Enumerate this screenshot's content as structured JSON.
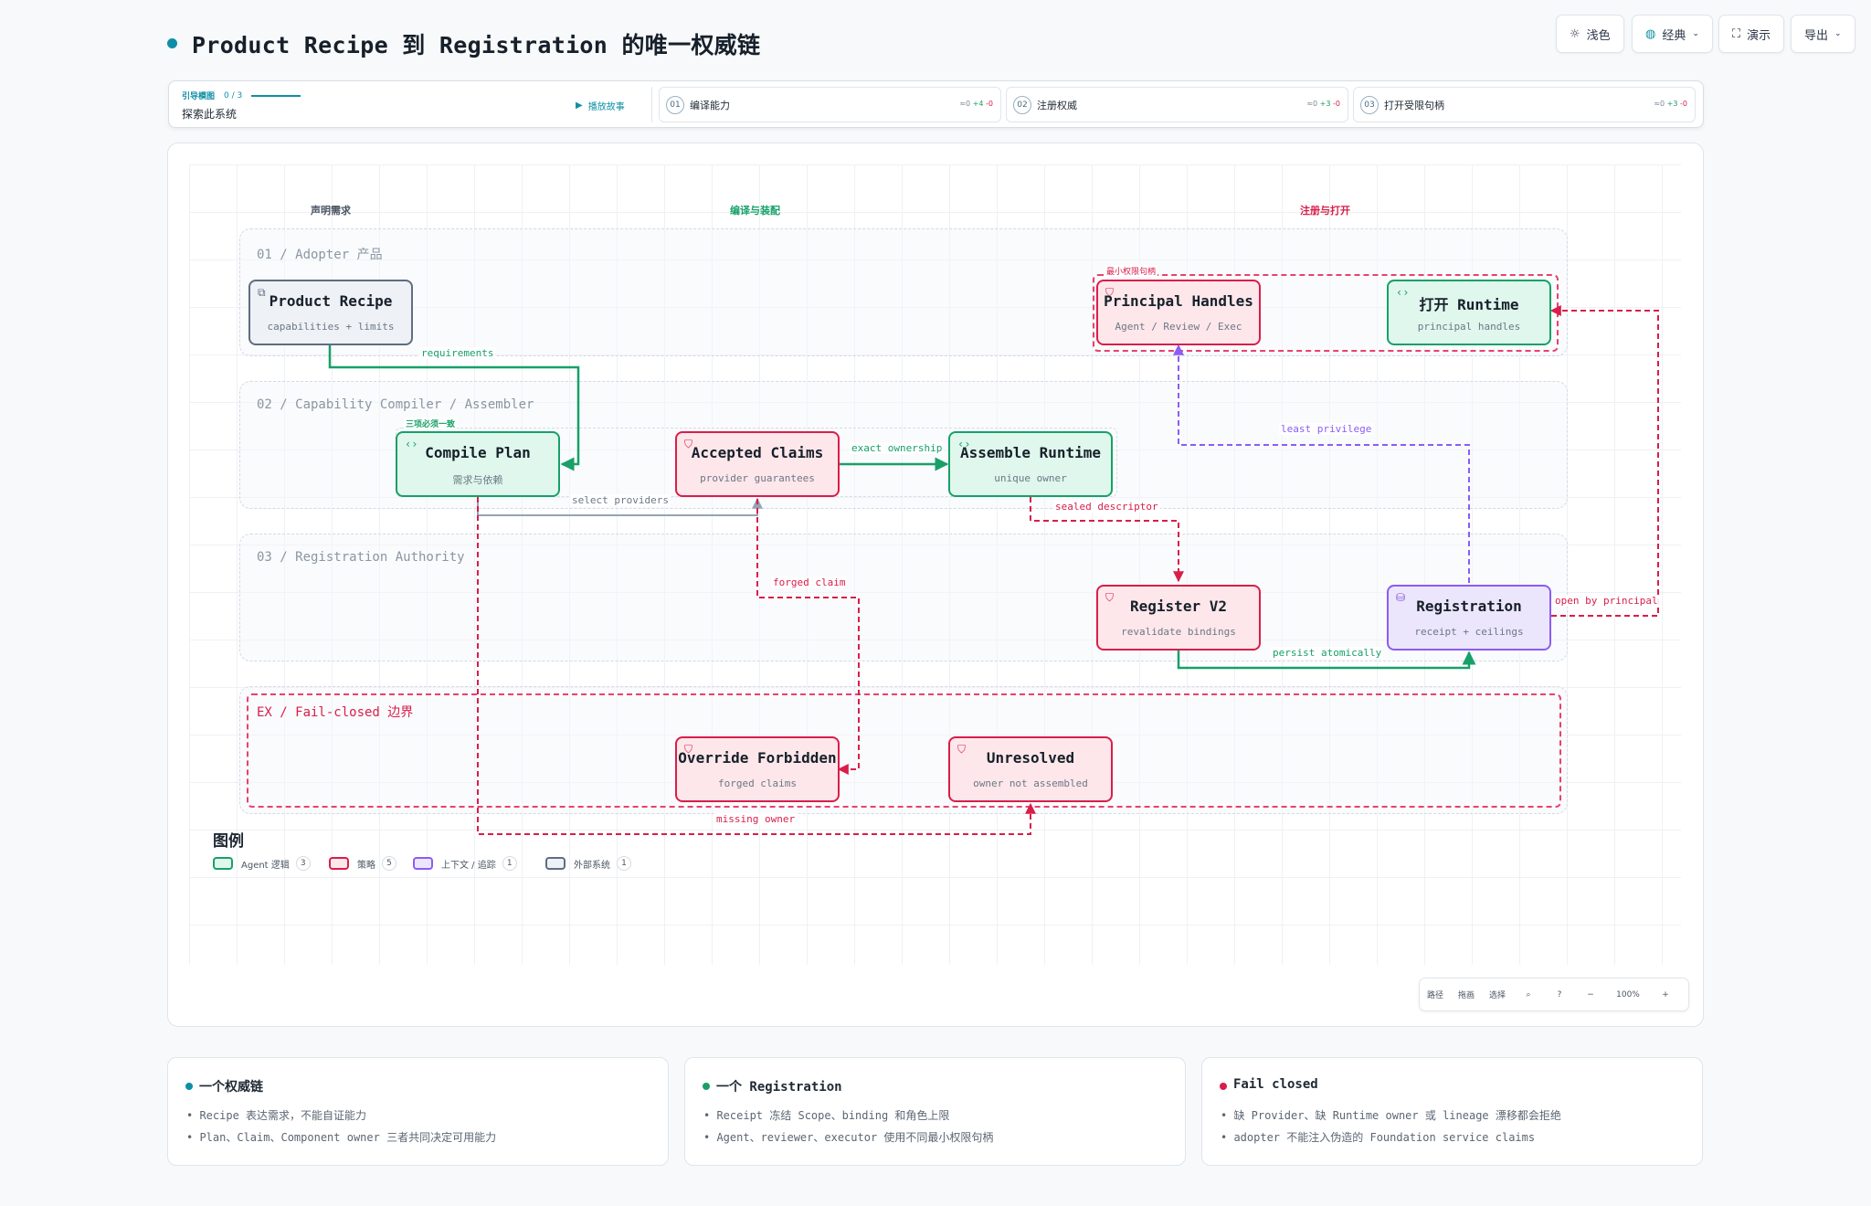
{
  "header": {
    "title": "Product Recipe 到 Registration 的唯一权威链"
  },
  "toolbar": {
    "theme": "浅色",
    "style": "经典",
    "present": "演示",
    "export": "导出"
  },
  "guide": {
    "label": "引导模图",
    "progress": "0 / 3",
    "progress_value": 0,
    "subtitle": "探索此系统",
    "play": "播放故事",
    "steps": [
      {
        "num": "01",
        "label": "编译能力",
        "stat_neutral": "≈0",
        "stat_plus": "+4",
        "stat_minus": "-0"
      },
      {
        "num": "02",
        "label": "注册权威",
        "stat_neutral": "≈0",
        "stat_plus": "+3",
        "stat_minus": "-0"
      },
      {
        "num": "03",
        "label": "打开受限句柄",
        "stat_neutral": "≈0",
        "stat_plus": "+3",
        "stat_minus": "-0"
      }
    ]
  },
  "columns": {
    "declare": "声明需求",
    "compile": "编译与装配",
    "register": "注册与打开"
  },
  "lanes": {
    "l1": "01 / Adopter 产品",
    "l2": "02 / Capability Compiler / Assembler",
    "l3": "03 / Registration Authority",
    "ex": "EX / Fail-closed 边界"
  },
  "groups": {
    "least_handles": "最小权限句柄",
    "three_consistent": "三项必须一致"
  },
  "nodes": {
    "product_recipe": {
      "title": "Product Recipe",
      "sub": "capabilities + limits"
    },
    "principal_handles": {
      "title": "Principal Handles",
      "sub": "Agent / Review / Exec"
    },
    "open_runtime": {
      "title": "打开 Runtime",
      "sub": "principal handles"
    },
    "compile_plan": {
      "title": "Compile Plan",
      "sub": "需求与依赖"
    },
    "accepted_claims": {
      "title": "Accepted Claims",
      "sub": "provider guarantees"
    },
    "assemble_runtime": {
      "title": "Assemble Runtime",
      "sub": "unique owner"
    },
    "register_v2": {
      "title": "Register V2",
      "sub": "revalidate bindings"
    },
    "registration": {
      "title": "Registration",
      "sub": "receipt + ceilings"
    },
    "override_forbidden": {
      "title": "Override Forbidden",
      "sub": "forged claims"
    },
    "unresolved": {
      "title": "Unresolved",
      "sub": "owner not assembled"
    }
  },
  "edges": {
    "requirements": "requirements",
    "exact_ownership": "exact ownership",
    "select_providers": "select providers",
    "sealed_descriptor": "sealed descriptor",
    "least_privilege": "least privilege",
    "forged_claim": "forged claim",
    "persist_atomically": "persist atomically",
    "open_by_principal": "open by principal",
    "missing_owner": "missing owner"
  },
  "legend": {
    "title": "图例",
    "items": [
      {
        "label": "Agent 逻辑",
        "count": "3"
      },
      {
        "label": "策略",
        "count": "5"
      },
      {
        "label": "上下文 / 追踪",
        "count": "1"
      },
      {
        "label": "外部系统",
        "count": "1"
      }
    ]
  },
  "zoom": {
    "path": "路径",
    "drag": "拖画",
    "select": "选择",
    "level": "100%",
    "minus": "−",
    "plus": "+"
  },
  "cards": [
    {
      "title": "一个权威链",
      "lines": [
        "Recipe 表达需求，不能自证能力",
        "Plan、Claim、Component owner 三者共同决定可用能力"
      ]
    },
    {
      "title": "一个 Registration",
      "lines": [
        "Receipt 冻结 Scope、binding 和角色上限",
        "Agent、reviewer、executor 使用不同最小权限句柄"
      ]
    },
    {
      "title": "Fail closed",
      "lines": [
        "缺 Provider、缺 Runtime owner 或 lineage 漂移都会拒绝",
        "adopter 不能注入伪造的 Foundation service claims"
      ]
    }
  ],
  "colors": {
    "green": "#17a068",
    "red": "#d81e4a",
    "purple": "#8b5cf6",
    "gray": "#5e6d80",
    "accent": "#0e8fa6"
  }
}
